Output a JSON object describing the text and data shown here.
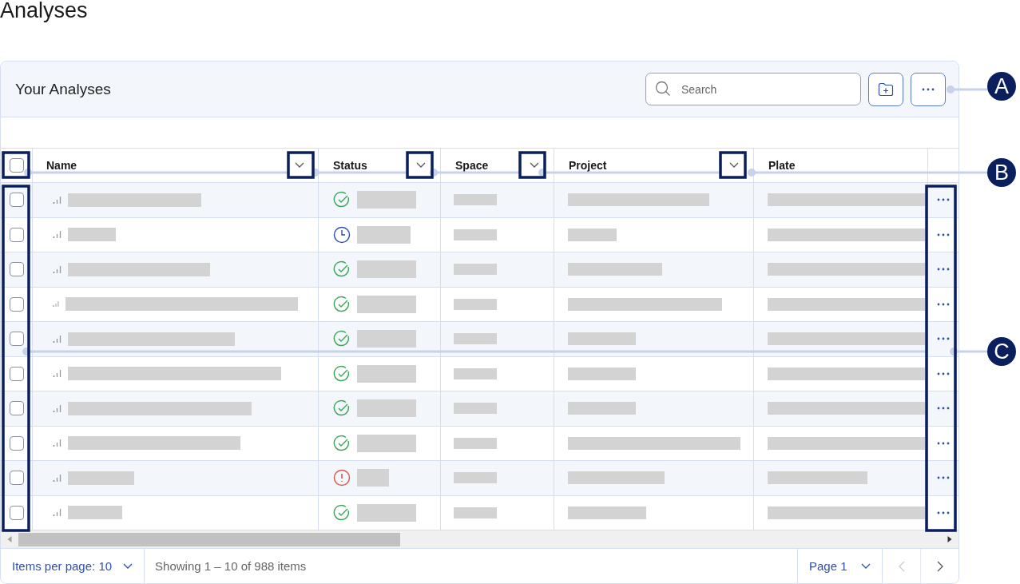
{
  "page_title": "Analyses",
  "panel": {
    "title": "Your Analyses",
    "search": {
      "placeholder": "Search"
    }
  },
  "table": {
    "select_all": {
      "checked": false
    },
    "columns": [
      {
        "label": "Name",
        "has_menu": true
      },
      {
        "label": "Status",
        "has_menu": true
      },
      {
        "label": "Space",
        "has_menu": true
      },
      {
        "label": "Project",
        "has_menu": true
      },
      {
        "label": "Plate",
        "has_menu": false
      }
    ],
    "rows": [
      {
        "checked": false,
        "kind": "done"
      },
      {
        "checked": false,
        "kind": "pending"
      },
      {
        "checked": false,
        "kind": "done"
      },
      {
        "checked": false,
        "kind": "done"
      },
      {
        "checked": false,
        "kind": "done"
      },
      {
        "checked": false,
        "kind": "done"
      },
      {
        "checked": false,
        "kind": "done"
      },
      {
        "checked": false,
        "kind": "done"
      },
      {
        "checked": false,
        "kind": "error"
      },
      {
        "checked": false,
        "kind": "done"
      }
    ]
  },
  "footer": {
    "items_per_page": "Items per page: 10",
    "summary": "Showing 1 – 10 of 988 items",
    "page": "Page 1",
    "prev": {
      "disabled": true
    },
    "next": {
      "disabled": false
    }
  },
  "callouts": [
    {
      "label": "A"
    },
    {
      "label": "B"
    },
    {
      "label": "C"
    }
  ]
}
